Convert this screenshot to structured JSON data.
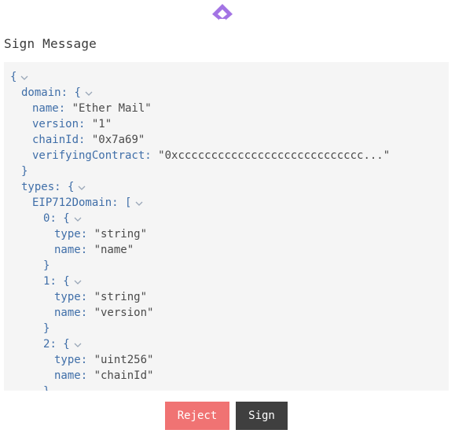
{
  "colors": {
    "logo": "#a374e4",
    "json_key": "#3f6ea8",
    "json_string": "#4a4a4a",
    "panel_bg": "#f5f5f5",
    "reject_bg": "#f07373",
    "sign_bg": "#3f3f3f"
  },
  "logo": {
    "icon": "diamond-arrow-logo-icon"
  },
  "title": "Sign Message",
  "json_lines": [
    {
      "indent": 0,
      "parts": [
        [
          "brace",
          "{"
        ]
      ],
      "chevron": true
    },
    {
      "indent": 1,
      "parts": [
        [
          "key",
          "domain"
        ],
        [
          "colon",
          ": "
        ],
        [
          "brace",
          "{"
        ]
      ],
      "chevron": true
    },
    {
      "indent": 2,
      "parts": [
        [
          "key",
          "name"
        ],
        [
          "colon",
          ": "
        ],
        [
          "str",
          "\"Ether Mail\""
        ]
      ]
    },
    {
      "indent": 2,
      "parts": [
        [
          "key",
          "version"
        ],
        [
          "colon",
          ": "
        ],
        [
          "str",
          "\"1\""
        ]
      ]
    },
    {
      "indent": 2,
      "parts": [
        [
          "key",
          "chainId"
        ],
        [
          "colon",
          ": "
        ],
        [
          "str",
          "\"0x7a69\""
        ]
      ]
    },
    {
      "indent": 2,
      "parts": [
        [
          "key",
          "verifyingContract"
        ],
        [
          "colon",
          ": "
        ],
        [
          "str",
          "\"0xcccccccccccccccccccccccccccc...\""
        ]
      ]
    },
    {
      "indent": 1,
      "parts": [
        [
          "brace",
          "}"
        ]
      ]
    },
    {
      "indent": 1,
      "parts": [
        [
          "key",
          "types"
        ],
        [
          "colon",
          ": "
        ],
        [
          "brace",
          "{"
        ]
      ],
      "chevron": true
    },
    {
      "indent": 2,
      "parts": [
        [
          "key",
          "EIP712Domain"
        ],
        [
          "colon",
          ": "
        ],
        [
          "brace",
          "["
        ]
      ],
      "chevron": true
    },
    {
      "indent": 3,
      "parts": [
        [
          "key",
          "0"
        ],
        [
          "colon",
          ": "
        ],
        [
          "brace",
          "{"
        ]
      ],
      "chevron": true
    },
    {
      "indent": 4,
      "parts": [
        [
          "key",
          "type"
        ],
        [
          "colon",
          ": "
        ],
        [
          "str",
          "\"string\""
        ]
      ]
    },
    {
      "indent": 4,
      "parts": [
        [
          "key",
          "name"
        ],
        [
          "colon",
          ": "
        ],
        [
          "str",
          "\"name\""
        ]
      ]
    },
    {
      "indent": 3,
      "parts": [
        [
          "brace",
          "}"
        ]
      ]
    },
    {
      "indent": 3,
      "parts": [
        [
          "key",
          "1"
        ],
        [
          "colon",
          ": "
        ],
        [
          "brace",
          "{"
        ]
      ],
      "chevron": true
    },
    {
      "indent": 4,
      "parts": [
        [
          "key",
          "type"
        ],
        [
          "colon",
          ": "
        ],
        [
          "str",
          "\"string\""
        ]
      ]
    },
    {
      "indent": 4,
      "parts": [
        [
          "key",
          "name"
        ],
        [
          "colon",
          ": "
        ],
        [
          "str",
          "\"version\""
        ]
      ]
    },
    {
      "indent": 3,
      "parts": [
        [
          "brace",
          "}"
        ]
      ]
    },
    {
      "indent": 3,
      "parts": [
        [
          "key",
          "2"
        ],
        [
          "colon",
          ": "
        ],
        [
          "brace",
          "{"
        ]
      ],
      "chevron": true
    },
    {
      "indent": 4,
      "parts": [
        [
          "key",
          "type"
        ],
        [
          "colon",
          ": "
        ],
        [
          "str",
          "\"uint256\""
        ]
      ]
    },
    {
      "indent": 4,
      "parts": [
        [
          "key",
          "name"
        ],
        [
          "colon",
          ": "
        ],
        [
          "str",
          "\"chainId\""
        ]
      ]
    },
    {
      "indent": 3,
      "parts": [
        [
          "brace",
          "}"
        ]
      ]
    }
  ],
  "buttons": {
    "reject": "Reject",
    "sign": "Sign"
  }
}
